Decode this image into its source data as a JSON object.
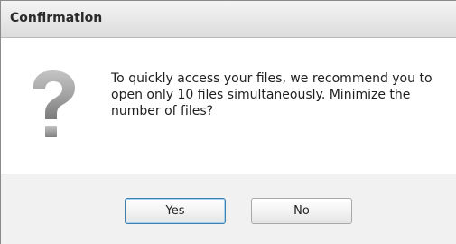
{
  "dialog": {
    "title": "Confirmation",
    "icon": "question-mark-icon",
    "message": "To quickly access your files, we recommend you to open only 10 files simultaneously. Minimize the number of files?",
    "buttons": {
      "yes_label": "Yes",
      "no_label": "No"
    },
    "colors": {
      "default_button_border": "#3c7fb1",
      "icon_gray": "#9e9e9e"
    }
  }
}
